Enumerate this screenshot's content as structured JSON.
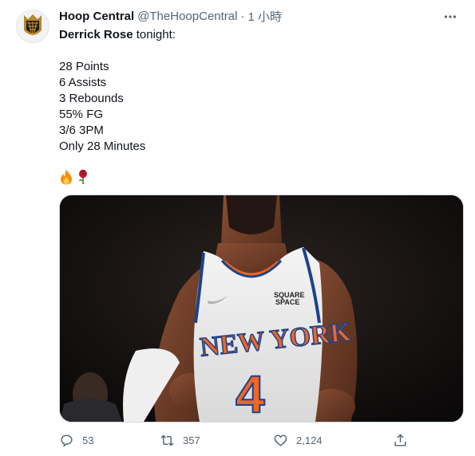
{
  "tweet": {
    "display_name": "Hoop Central",
    "handle": "@TheHoopCentral",
    "separator": "·",
    "time": "1 小時",
    "text": {
      "subject": "Derrick Rose",
      "rest": " tonight:",
      "stats": [
        "28 Points",
        "6 Assists",
        "3 Rebounds",
        "55% FG",
        "3/6 3PM",
        "Only 28 Minutes"
      ],
      "emojis": [
        "fire-emoji",
        "rose-emoji"
      ]
    },
    "media": {
      "jersey_team": "NEW YORK",
      "jersey_number": "4",
      "sponsor_line1": "SQUARE",
      "sponsor_line2": "SPACE"
    },
    "actions": {
      "replies": "53",
      "retweets": "357",
      "likes": "2,124"
    }
  },
  "colors": {
    "text": "#0f1419",
    "secondary": "#536471",
    "knicks_orange": "#f26522",
    "knicks_blue": "#1d428a"
  }
}
